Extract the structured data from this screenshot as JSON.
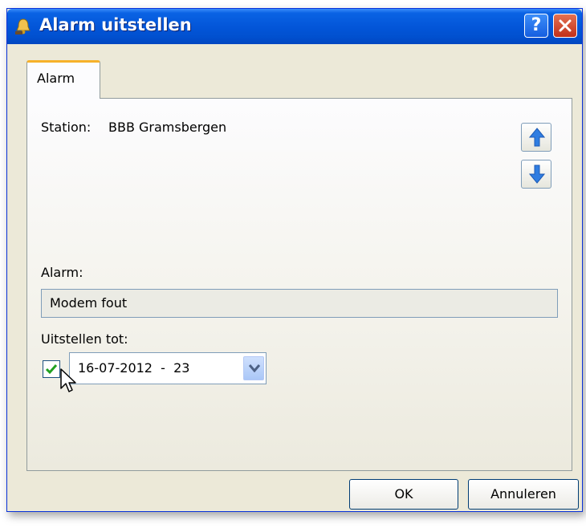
{
  "window": {
    "title": "Alarm uitstellen",
    "help_label": "?"
  },
  "tabs": [
    {
      "label": "Alarm",
      "active": true
    }
  ],
  "station": {
    "label": "Station:",
    "value": "BBB Gramsbergen"
  },
  "alarm": {
    "label": "Alarm:",
    "value": "Modem fout"
  },
  "postpone": {
    "label": "Uitstellen tot:",
    "checked": true,
    "value": "16-07-2012  -  23"
  },
  "buttons": {
    "ok": "OK",
    "cancel": "Annuleren"
  },
  "icons": {
    "title": "bell-icon",
    "up": "arrow-up-icon",
    "down": "arrow-down-icon",
    "dropdown": "chevron-down-icon"
  },
  "colors": {
    "titlebar": "#0356d9",
    "tab_accent": "#f6b12a",
    "arrow": "#2f7de1"
  }
}
